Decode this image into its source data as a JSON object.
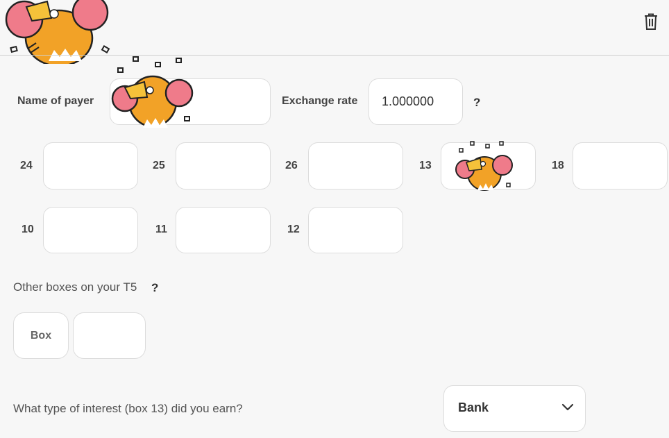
{
  "toolbar": {
    "delete_icon": "trash-icon"
  },
  "payer": {
    "name_label": "Name of payer",
    "name_value": "",
    "exchange_label": "Exchange rate",
    "exchange_value": "1.000000",
    "help": "?"
  },
  "boxes": {
    "row1": [
      {
        "label": "24",
        "value": ""
      },
      {
        "label": "25",
        "value": ""
      },
      {
        "label": "26",
        "value": ""
      },
      {
        "label": "13",
        "value": ""
      },
      {
        "label": "18",
        "value": ""
      }
    ],
    "row2": [
      {
        "label": "10",
        "value": ""
      },
      {
        "label": "11",
        "value": ""
      },
      {
        "label": "12",
        "value": ""
      }
    ]
  },
  "other": {
    "label": "Other boxes on your T5",
    "help": "?",
    "box_button": "Box",
    "box_value": ""
  },
  "interest": {
    "question": "What type of interest (box 13) did you earn?",
    "selected": "Bank"
  },
  "colors": {
    "background": "#f7f7f7",
    "field_border": "#dcdcdc",
    "sticker_orange": "#f2a227",
    "sticker_pink": "#ef7b8a"
  }
}
